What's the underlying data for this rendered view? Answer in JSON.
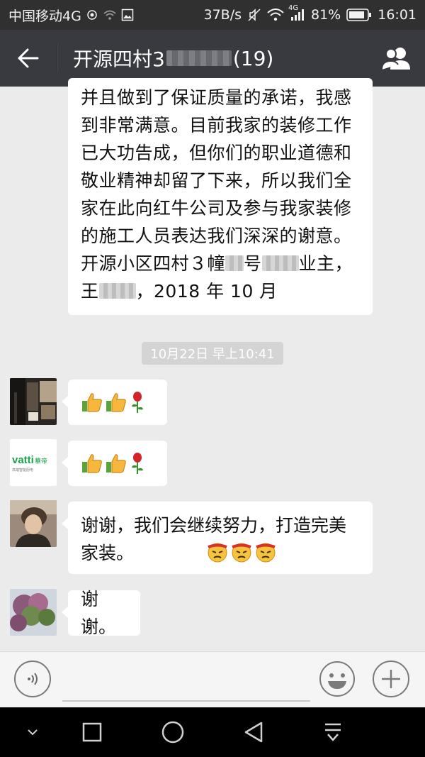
{
  "status_bar": {
    "carrier": "中国移动4G",
    "net_speed": "37B/s",
    "network_type": "4G",
    "battery": "81%",
    "time": "16:01"
  },
  "header": {
    "title_prefix": "开源四村3",
    "title_count": "(19)"
  },
  "messages": {
    "long_text": {
      "line1": "并且做到了保证质量的承诺，我感",
      "line2": "到非常满意。目前我家的装修工作",
      "line3": "已大功告成，但你们的职业道德和",
      "line4": "敬业精神却留了下来，所以我们全",
      "line5": "家在此向红牛公司及参与我家装修",
      "line6": "的施工人员表达我们深深的谢意。",
      "line7_a": "开源小区四村３幢",
      "line7_b": "号",
      "line7_c": "业主，",
      "line8_a": "王",
      "line8_b": "，2018 年 10 月"
    },
    "timestamp": "10月22日 早上10:41",
    "reply3": "谢谢，我们会继续努力，打造完美家装。",
    "reply4": "谢谢。",
    "avatar2_brand": "vatti",
    "avatar2_brand_cn": "華帝",
    "avatar2_slogan": "高端智能厨电"
  },
  "input": {
    "placeholder": ""
  },
  "colors": {
    "statusbar_bg": "#303030",
    "titlebar_bg": "#393a3f",
    "chat_bg": "#ebebeb",
    "bubble_bg": "#ffffff",
    "vatti_green": "#1aa34a"
  }
}
